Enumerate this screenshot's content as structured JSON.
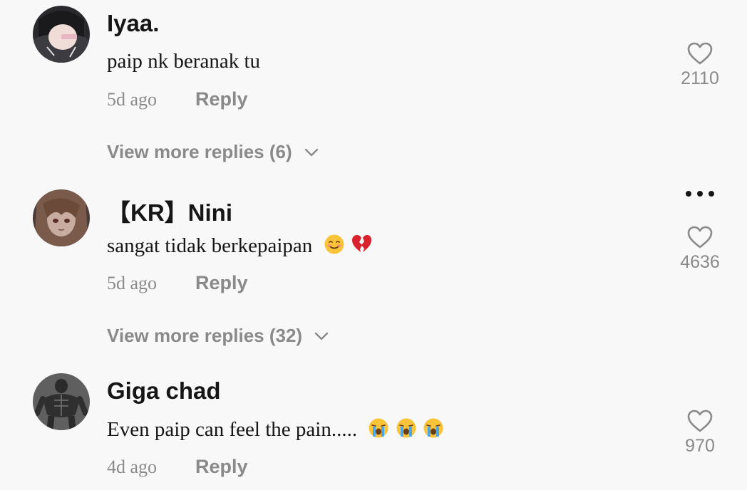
{
  "comments": [
    {
      "username": "Iyaa.",
      "text": "paip nk beranak tu",
      "time": "5d ago",
      "reply_label": "Reply",
      "likes": "2110",
      "view_more": "View more replies (6)",
      "avatar_icon": "user-avatar-photo"
    },
    {
      "username": "【KR】Nini",
      "text": "sangat tidak berkepaipan",
      "emojis": [
        "smiling-face-icon",
        "broken-heart-icon"
      ],
      "time": "5d ago",
      "reply_label": "Reply",
      "likes": "4636",
      "view_more": "View more replies (32)",
      "avatar_icon": "anime-avatar"
    },
    {
      "username": "Giga chad",
      "text": "Even paip can feel the pain.....",
      "emojis": [
        "loudly-crying-face-icon",
        "loudly-crying-face-icon",
        "loudly-crying-face-icon"
      ],
      "time": "4d ago",
      "reply_label": "Reply",
      "likes": "970",
      "avatar_icon": "muscle-man-avatar"
    }
  ],
  "colors": {
    "background": "#f8f8f8",
    "primary_text": "#161616",
    "secondary_text": "#8a8a8a"
  }
}
